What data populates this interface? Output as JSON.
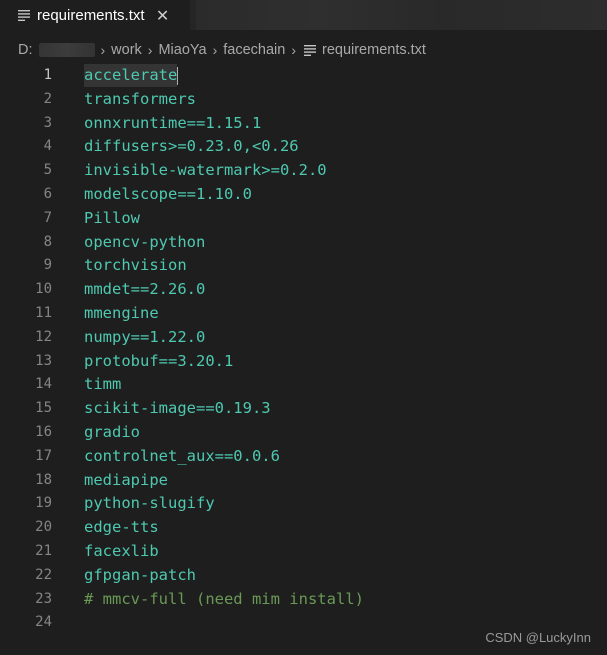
{
  "tab": {
    "title": "requirements.txt",
    "close_glyph": "✕",
    "icon": "list-lines-icon"
  },
  "breadcrumb": {
    "drive": "D:",
    "items": [
      "work",
      "MiaoYa",
      "facechain"
    ],
    "file": "requirements.txt",
    "separator": "›"
  },
  "editor": {
    "lines": [
      {
        "num": "1",
        "text": "accelerate"
      },
      {
        "num": "2",
        "text": "transformers"
      },
      {
        "num": "3",
        "text": "onnxruntime==1.15.1"
      },
      {
        "num": "4",
        "text": "diffusers>=0.23.0,<0.26"
      },
      {
        "num": "5",
        "text": "invisible-watermark>=0.2.0"
      },
      {
        "num": "6",
        "text": "modelscope==1.10.0"
      },
      {
        "num": "7",
        "text": "Pillow"
      },
      {
        "num": "8",
        "text": "opencv-python"
      },
      {
        "num": "9",
        "text": "torchvision"
      },
      {
        "num": "10",
        "text": "mmdet==2.26.0"
      },
      {
        "num": "11",
        "text": "mmengine"
      },
      {
        "num": "12",
        "text": "numpy==1.22.0"
      },
      {
        "num": "13",
        "text": "protobuf==3.20.1"
      },
      {
        "num": "14",
        "text": "timm"
      },
      {
        "num": "15",
        "text": "scikit-image==0.19.3"
      },
      {
        "num": "16",
        "text": "gradio"
      },
      {
        "num": "17",
        "text": "controlnet_aux==0.0.6"
      },
      {
        "num": "18",
        "text": "mediapipe"
      },
      {
        "num": "19",
        "text": "python-slugify"
      },
      {
        "num": "20",
        "text": "edge-tts"
      },
      {
        "num": "21",
        "text": "facexlib"
      },
      {
        "num": "22",
        "text": "gfpgan-patch"
      },
      {
        "num": "23",
        "text": "# mmcv-full (need mim install)"
      },
      {
        "num": "24",
        "text": ""
      }
    ],
    "active_line": 1,
    "colors": {
      "text": "#4ec9b0",
      "comment": "#6a9955",
      "line_number": "#858585",
      "background": "#1e1e1e"
    }
  },
  "watermark": "CSDN @LuckyInn"
}
